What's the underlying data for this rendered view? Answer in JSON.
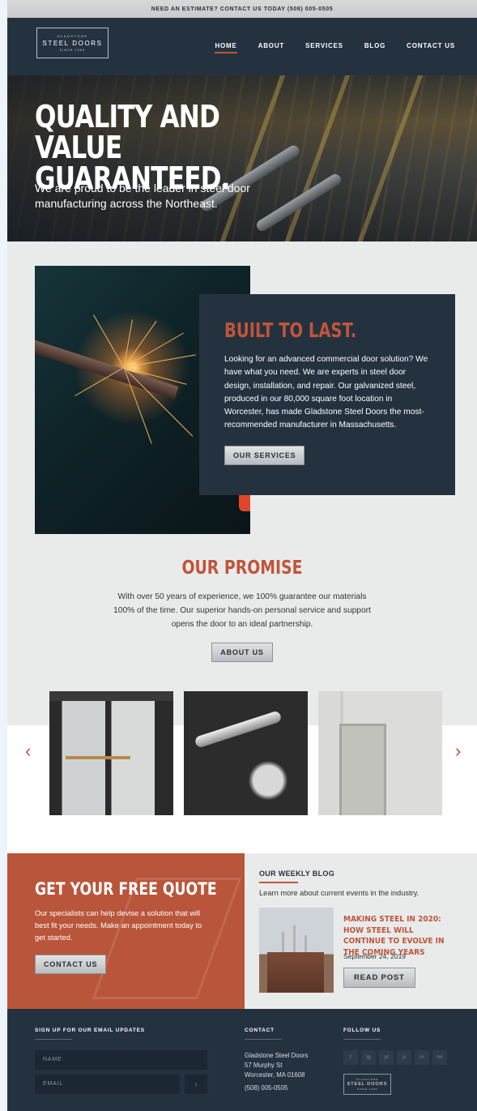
{
  "topbar": {
    "text": "NEED AN ESTIMATE? CONTACT US TODAY (508) 005-0505"
  },
  "logo": {
    "line1": "GLADSTONE",
    "line2": "STEEL DOORS",
    "line3": "SINCE 1955"
  },
  "nav": {
    "items": [
      "HOME",
      "ABOUT",
      "SERVICES",
      "BLOG",
      "CONTACT US"
    ],
    "active": "HOME"
  },
  "hero": {
    "title": "QUALITY AND VALUE GUARANTEED.",
    "subtitle": "We are proud to be the leader in steel door manufacturing across the Northeast."
  },
  "built": {
    "title": "BUILT TO LAST.",
    "body": "Looking for an advanced commercial door solution? We have what you need. We are experts in steel door design, installation, and repair. Our galvanized steel, produced in our 80,000 square foot location in Worcester, has made Gladstone Steel Doors the most-recommended manufacturer in Massachusetts.",
    "button": "OUR SERVICES"
  },
  "promise": {
    "title": "OUR PROMISE",
    "body": "With over 50 years of experience, we 100% guarantee our materials 100% of the time. Our superior hands-on personal service and support opens the door to an ideal partnership.",
    "button": "ABOUT US"
  },
  "carousel": {
    "prev": "‹",
    "next": "›"
  },
  "quote": {
    "title": "GET YOUR FREE QUOTE",
    "body": "Our specialists can help devise a solution that will best fit your needs. Make an appointment today to get started.",
    "button": "CONTACT US"
  },
  "blog": {
    "title": "OUR WEEKLY BLOG",
    "subtitle": "Learn more about current events in the industry.",
    "post_title": "MAKING STEEL IN 2020: HOW STEEL WILL CONTINUE TO EVOLVE IN THE COMING YEARS",
    "post_date": "September 24, 2019",
    "button": "READ POST"
  },
  "footer": {
    "signup_heading": "SIGN UP FOR OUR EMAIL UPDATES",
    "name_placeholder": "NAME",
    "email_placeholder": "EMAIL",
    "send_glyph": "›",
    "contact_heading": "CONTACT",
    "contact_name": "Gladstone Steel Doors",
    "contact_street": "57 Murphy St",
    "contact_city": "Worcester, MA 01608",
    "contact_phone": "(508) 005-0505",
    "follow_heading": "FOLLOW US",
    "social": [
      "f",
      "ig",
      "yt",
      "p",
      "in",
      "tw"
    ]
  },
  "colors": {
    "accent": "#c0553a",
    "navy": "#243240",
    "quote_bg": "#b9553a"
  }
}
